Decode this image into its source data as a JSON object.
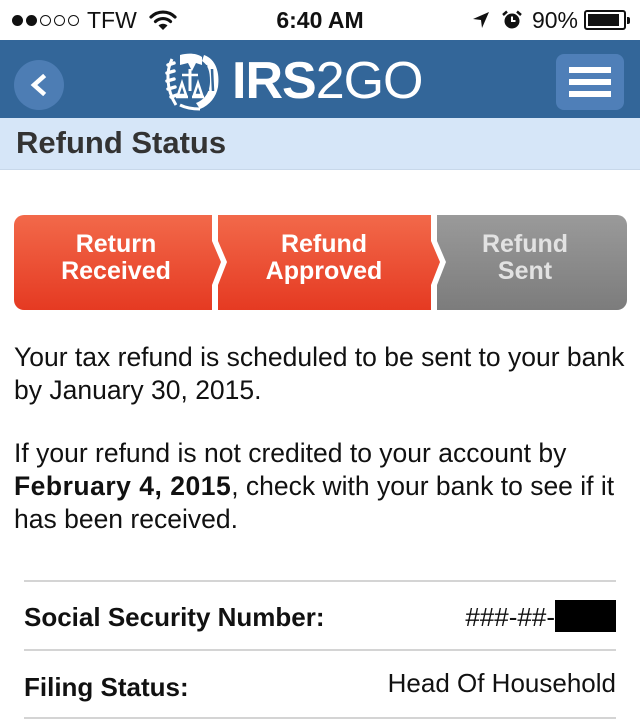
{
  "status_bar": {
    "signal_strength": 2,
    "signal_max": 5,
    "carrier": "TFW",
    "time": "6:40 AM",
    "battery_percent_label": "90%",
    "battery_level": 0.9,
    "icons": [
      "signal-dots-icon",
      "wifi-icon",
      "location-arrow-icon",
      "alarm-clock-icon",
      "battery-icon"
    ]
  },
  "navbar": {
    "back_icon": "chevron-left-icon",
    "logo_bold": "IRS",
    "logo_light": "2GO",
    "logo_emblem": "irs-eagle-emblem-icon",
    "menu_icon": "hamburger-menu-icon"
  },
  "page": {
    "title": "Refund Status"
  },
  "progress": {
    "steps": [
      {
        "line1": "Return",
        "line2": "Received",
        "state": "complete"
      },
      {
        "line1": "Refund",
        "line2": "Approved",
        "state": "complete"
      },
      {
        "line1": "Refund",
        "line2": "Sent",
        "state": "pending"
      }
    ],
    "colors": {
      "complete_top": "#f2694a",
      "complete_bottom": "#e53a22",
      "pending_top": "#9a9a9a",
      "pending_bottom": "#7c7c7c"
    }
  },
  "message": {
    "line1": "Your tax refund is scheduled to be sent to your bank by January 30, 2015.",
    "line2_prefix": "If your refund is not credited to your account by ",
    "line2_bold": "February 4, 2015",
    "line2_suffix": ", check with your bank to see if it has been received."
  },
  "info": {
    "ssn_label": "Social Security Number:",
    "ssn_value": "###-##-",
    "ssn_redacted": true,
    "filing_label": "Filing Status:",
    "filing_value": "Head Of Household"
  },
  "colors": {
    "navbar": "#336699",
    "page_header": "#d6e6f8",
    "button_bg": "#4f7fb8"
  }
}
